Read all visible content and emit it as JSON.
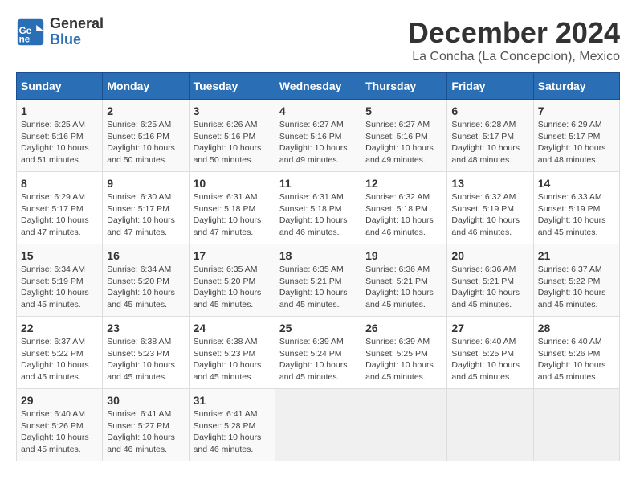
{
  "logo": {
    "general": "General",
    "blue": "Blue"
  },
  "title": "December 2024",
  "location": "La Concha (La Concepcion), Mexico",
  "header": {
    "days": [
      "Sunday",
      "Monday",
      "Tuesday",
      "Wednesday",
      "Thursday",
      "Friday",
      "Saturday"
    ]
  },
  "weeks": [
    [
      {
        "day": "1",
        "sunrise": "6:25 AM",
        "sunset": "5:16 PM",
        "daylight": "10 hours and 51 minutes."
      },
      {
        "day": "2",
        "sunrise": "6:25 AM",
        "sunset": "5:16 PM",
        "daylight": "10 hours and 50 minutes."
      },
      {
        "day": "3",
        "sunrise": "6:26 AM",
        "sunset": "5:16 PM",
        "daylight": "10 hours and 50 minutes."
      },
      {
        "day": "4",
        "sunrise": "6:27 AM",
        "sunset": "5:16 PM",
        "daylight": "10 hours and 49 minutes."
      },
      {
        "day": "5",
        "sunrise": "6:27 AM",
        "sunset": "5:16 PM",
        "daylight": "10 hours and 49 minutes."
      },
      {
        "day": "6",
        "sunrise": "6:28 AM",
        "sunset": "5:17 PM",
        "daylight": "10 hours and 48 minutes."
      },
      {
        "day": "7",
        "sunrise": "6:29 AM",
        "sunset": "5:17 PM",
        "daylight": "10 hours and 48 minutes."
      }
    ],
    [
      {
        "day": "8",
        "sunrise": "6:29 AM",
        "sunset": "5:17 PM",
        "daylight": "10 hours and 47 minutes."
      },
      {
        "day": "9",
        "sunrise": "6:30 AM",
        "sunset": "5:17 PM",
        "daylight": "10 hours and 47 minutes."
      },
      {
        "day": "10",
        "sunrise": "6:31 AM",
        "sunset": "5:18 PM",
        "daylight": "10 hours and 47 minutes."
      },
      {
        "day": "11",
        "sunrise": "6:31 AM",
        "sunset": "5:18 PM",
        "daylight": "10 hours and 46 minutes."
      },
      {
        "day": "12",
        "sunrise": "6:32 AM",
        "sunset": "5:18 PM",
        "daylight": "10 hours and 46 minutes."
      },
      {
        "day": "13",
        "sunrise": "6:32 AM",
        "sunset": "5:19 PM",
        "daylight": "10 hours and 46 minutes."
      },
      {
        "day": "14",
        "sunrise": "6:33 AM",
        "sunset": "5:19 PM",
        "daylight": "10 hours and 45 minutes."
      }
    ],
    [
      {
        "day": "15",
        "sunrise": "6:34 AM",
        "sunset": "5:19 PM",
        "daylight": "10 hours and 45 minutes."
      },
      {
        "day": "16",
        "sunrise": "6:34 AM",
        "sunset": "5:20 PM",
        "daylight": "10 hours and 45 minutes."
      },
      {
        "day": "17",
        "sunrise": "6:35 AM",
        "sunset": "5:20 PM",
        "daylight": "10 hours and 45 minutes."
      },
      {
        "day": "18",
        "sunrise": "6:35 AM",
        "sunset": "5:21 PM",
        "daylight": "10 hours and 45 minutes."
      },
      {
        "day": "19",
        "sunrise": "6:36 AM",
        "sunset": "5:21 PM",
        "daylight": "10 hours and 45 minutes."
      },
      {
        "day": "20",
        "sunrise": "6:36 AM",
        "sunset": "5:21 PM",
        "daylight": "10 hours and 45 minutes."
      },
      {
        "day": "21",
        "sunrise": "6:37 AM",
        "sunset": "5:22 PM",
        "daylight": "10 hours and 45 minutes."
      }
    ],
    [
      {
        "day": "22",
        "sunrise": "6:37 AM",
        "sunset": "5:22 PM",
        "daylight": "10 hours and 45 minutes."
      },
      {
        "day": "23",
        "sunrise": "6:38 AM",
        "sunset": "5:23 PM",
        "daylight": "10 hours and 45 minutes."
      },
      {
        "day": "24",
        "sunrise": "6:38 AM",
        "sunset": "5:23 PM",
        "daylight": "10 hours and 45 minutes."
      },
      {
        "day": "25",
        "sunrise": "6:39 AM",
        "sunset": "5:24 PM",
        "daylight": "10 hours and 45 minutes."
      },
      {
        "day": "26",
        "sunrise": "6:39 AM",
        "sunset": "5:25 PM",
        "daylight": "10 hours and 45 minutes."
      },
      {
        "day": "27",
        "sunrise": "6:40 AM",
        "sunset": "5:25 PM",
        "daylight": "10 hours and 45 minutes."
      },
      {
        "day": "28",
        "sunrise": "6:40 AM",
        "sunset": "5:26 PM",
        "daylight": "10 hours and 45 minutes."
      }
    ],
    [
      {
        "day": "29",
        "sunrise": "6:40 AM",
        "sunset": "5:26 PM",
        "daylight": "10 hours and 45 minutes."
      },
      {
        "day": "30",
        "sunrise": "6:41 AM",
        "sunset": "5:27 PM",
        "daylight": "10 hours and 46 minutes."
      },
      {
        "day": "31",
        "sunrise": "6:41 AM",
        "sunset": "5:28 PM",
        "daylight": "10 hours and 46 minutes."
      },
      null,
      null,
      null,
      null
    ]
  ]
}
